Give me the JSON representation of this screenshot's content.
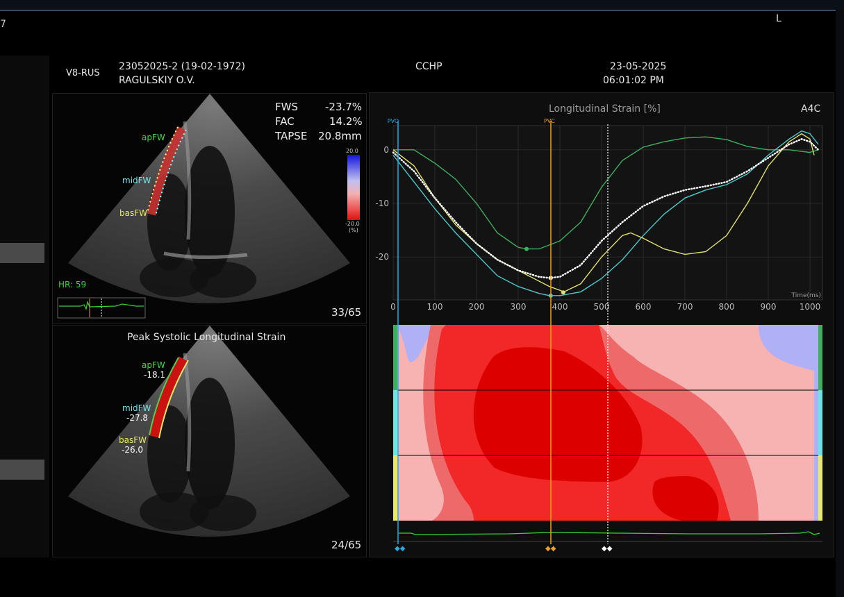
{
  "app": {
    "corner_text": "7",
    "lr_marker": "L"
  },
  "header": {
    "device": "V8-RUS",
    "patient_id": "23052025-2 (19-02-1972)",
    "patient_name": "RAGULSKIY O.V.",
    "institution": "CCHP",
    "date": "23-05-2025",
    "time": "06:01:02 PM"
  },
  "top_view": {
    "metrics": [
      {
        "label": "FWS",
        "value": "-23.7%"
      },
      {
        "label": "FAC",
        "value": "14.2%"
      },
      {
        "label": "TAPSE",
        "value": "20.8mm"
      }
    ],
    "colorbar": {
      "max": "20.0",
      "min": "-20.0",
      "unit": "(%)"
    },
    "segments": [
      {
        "label": "apFW",
        "color": "#4fd14f"
      },
      {
        "label": "midFW",
        "color": "#6fe3e3"
      },
      {
        "label": "basFW",
        "color": "#e8e86a"
      }
    ],
    "hr_label": "HR: 59",
    "frame": "33/65"
  },
  "bottom_view": {
    "title": "Peak Systolic Longitudinal Strain",
    "segments": [
      {
        "label": "apFW",
        "value": "-18.1",
        "color": "#4fd14f"
      },
      {
        "label": "midFW",
        "value": "-27.8",
        "color": "#6fe3e3"
      },
      {
        "label": "basFW",
        "value": "-26.0",
        "color": "#e8e86a"
      }
    ],
    "frame": "24/65"
  },
  "chart_data": {
    "type": "line",
    "title": "Longitudinal Strain [%]",
    "view_label": "A4C",
    "xlabel": "Time(ms)",
    "ylabel": "",
    "xlim": [
      0,
      1030
    ],
    "ylim": [
      -28,
      4.5
    ],
    "xticks": [
      0,
      100,
      200,
      300,
      400,
      500,
      600,
      700,
      800,
      900,
      1000
    ],
    "yticks": [
      0,
      -10,
      -20
    ],
    "markers": [
      {
        "label": "PVO",
        "x": 0,
        "color": "#2aa8e0"
      },
      {
        "label": "PVC",
        "x": 375,
        "color": "#f0a020"
      },
      {
        "label": "",
        "x": 515,
        "color": "#ffffff"
      }
    ],
    "series": [
      {
        "color": "#3fae5f",
        "style": "solid",
        "x": [
          0,
          50,
          100,
          150,
          200,
          250,
          300,
          320,
          350,
          400,
          450,
          500,
          550,
          600,
          650,
          700,
          750,
          800,
          850,
          900,
          950,
          1000,
          1020
        ],
        "y": [
          0,
          0,
          -2.5,
          -5.5,
          -10,
          -15.5,
          -18.2,
          -18.5,
          -18.5,
          -17,
          -13.5,
          -7,
          -2,
          0.5,
          1.5,
          2.2,
          2.4,
          1.9,
          0.6,
          0,
          0,
          -0.5,
          0
        ]
      },
      {
        "color": "#4fc8c8",
        "style": "solid",
        "x": [
          0,
          50,
          100,
          150,
          200,
          250,
          300,
          350,
          375,
          400,
          450,
          500,
          550,
          600,
          650,
          700,
          750,
          800,
          850,
          900,
          950,
          980,
          1000,
          1020
        ],
        "y": [
          -1,
          -6,
          -11,
          -15.5,
          -19.5,
          -23.5,
          -25.5,
          -26.8,
          -27.2,
          -27.2,
          -26.5,
          -24,
          -20.5,
          -16,
          -12,
          -9,
          -7.5,
          -6.5,
          -4.5,
          -1,
          2,
          3.5,
          3,
          1
        ]
      },
      {
        "color": "#e0e070",
        "style": "solid",
        "x": [
          0,
          50,
          100,
          150,
          200,
          250,
          300,
          350,
          375,
          410,
          450,
          500,
          550,
          570,
          600,
          650,
          700,
          750,
          800,
          850,
          900,
          950,
          980,
          1000,
          1010
        ],
        "y": [
          0,
          -3,
          -9,
          -14,
          -17.5,
          -20.5,
          -22.5,
          -24.5,
          -25.5,
          -26.5,
          -25,
          -20,
          -16,
          -15.5,
          -16.5,
          -18.5,
          -19.5,
          -19,
          -16,
          -10,
          -3,
          1.5,
          3,
          2,
          -1
        ]
      },
      {
        "color": "#ffffff",
        "style": "dotted",
        "x": [
          0,
          50,
          100,
          150,
          200,
          250,
          300,
          350,
          375,
          400,
          450,
          500,
          550,
          600,
          650,
          700,
          750,
          800,
          850,
          900,
          950,
          980,
          1000,
          1020
        ],
        "y": [
          -0.5,
          -4,
          -9,
          -13.5,
          -17.5,
          -20.5,
          -22.5,
          -23.7,
          -23.9,
          -23.7,
          -21.5,
          -17,
          -13.5,
          -10.5,
          -8.7,
          -7.5,
          -6.8,
          -6,
          -4,
          -1.5,
          1,
          2,
          1.5,
          0
        ]
      }
    ],
    "peak_points": [
      {
        "x": 320,
        "y": -18.5,
        "color": "#3fae5f"
      },
      {
        "x": 378,
        "y": -23.9,
        "color": "#ffffff"
      },
      {
        "x": 378,
        "y": -27.2,
        "color": "#4fc8c8"
      },
      {
        "x": 408,
        "y": -26.6,
        "color": "#e0e070"
      }
    ]
  }
}
